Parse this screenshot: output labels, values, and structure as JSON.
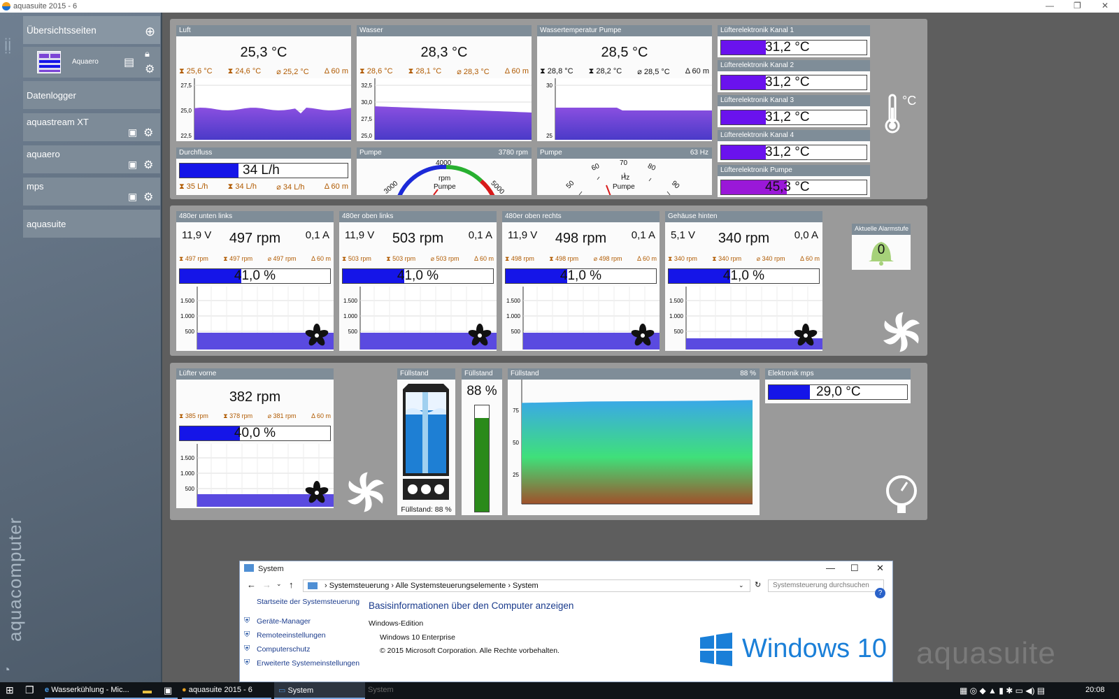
{
  "window": {
    "title": "aquasuite 2015 - 6",
    "watermark": "aquasuite"
  },
  "sidebar": {
    "overview": "Übersichtsseiten",
    "page_item": "Aquaero",
    "items": [
      {
        "label": "Datenlogger"
      },
      {
        "label": "aquastream XT"
      },
      {
        "label": "aquaero"
      },
      {
        "label": "mps"
      },
      {
        "label": "aquasuite"
      }
    ],
    "brand": "aquacomputer"
  },
  "temps": [
    {
      "title": "Luft",
      "value": "25,3 °C",
      "max": "25,6 °C",
      "min": "24,6 °C",
      "avg": "25,2 °C",
      "span": "60 m",
      "yticks": [
        "27,5",
        "25,0",
        "22,5"
      ]
    },
    {
      "title": "Wasser",
      "value": "28,3 °C",
      "max": "28,6 °C",
      "min": "28,1 °C",
      "avg": "28,3 °C",
      "span": "60 m",
      "yticks": [
        "32,5",
        "30,0",
        "27,5",
        "25,0"
      ]
    },
    {
      "title": "Wassertemperatur Pumpe",
      "value": "28,5 °C",
      "max": "28,8 °C",
      "min": "28,2 °C",
      "avg": "28,5 °C",
      "span": "60 m",
      "yticks": [
        "30",
        "25"
      ]
    }
  ],
  "flow": {
    "title": "Durchfluss",
    "value": "34 L/h",
    "max": "35 L/h",
    "min": "34 L/h",
    "avg": "34 L/h",
    "span": "60 m",
    "fill": 0.35
  },
  "pump_rpm": {
    "title": "Pumpe",
    "right": "3780 rpm",
    "ticks": [
      "3000",
      "4000",
      "5000"
    ],
    "unit": "rpm",
    "label": "Pumpe"
  },
  "pump_hz": {
    "title": "Pumpe",
    "right": "63 Hz",
    "ticks": [
      "50",
      "60",
      "70",
      "80",
      "90"
    ],
    "unit": "Hz",
    "label": "Pumpe"
  },
  "fan_channels": [
    {
      "title": "Lüfterelektronik Kanal 1",
      "value": "31,2 °C",
      "fill": 0.31
    },
    {
      "title": "Lüfterelektronik Kanal 2",
      "value": "31,2 °C",
      "fill": 0.31
    },
    {
      "title": "Lüfterelektronik Kanal 3",
      "value": "31,2 °C",
      "fill": 0.31
    },
    {
      "title": "Lüfterelektronik Kanal 4",
      "value": "31,2 °C",
      "fill": 0.31
    },
    {
      "title": "Lüfterelektronik Pumpe",
      "value": "45,3 °C",
      "fill": 0.45
    }
  ],
  "temp_unit_icon": "°C",
  "fans": [
    {
      "title": "480er unten links",
      "volt": "11,9 V",
      "rpm": "497 rpm",
      "amp": "0,1 A",
      "max": "497 rpm",
      "min": "497 rpm",
      "avg": "497 rpm",
      "span": "60 m",
      "pct": "41,0 %",
      "fill": 0.41
    },
    {
      "title": "480er oben links",
      "volt": "11,9 V",
      "rpm": "503 rpm",
      "amp": "0,1 A",
      "max": "503 rpm",
      "min": "503 rpm",
      "avg": "503 rpm",
      "span": "60 m",
      "pct": "41,0 %",
      "fill": 0.41
    },
    {
      "title": "480er oben rechts",
      "volt": "11,9 V",
      "rpm": "498 rpm",
      "amp": "0,1 A",
      "max": "498 rpm",
      "min": "498 rpm",
      "avg": "498 rpm",
      "span": "60 m",
      "pct": "41,0 %",
      "fill": 0.41
    },
    {
      "title": "Gehäuse hinten",
      "volt": "5,1 V",
      "rpm": "340 rpm",
      "amp": "0,0 A",
      "max": "340 rpm",
      "min": "340 rpm",
      "avg": "340 rpm",
      "span": "60 m",
      "pct": "41,0 %",
      "fill": 0.41
    }
  ],
  "fan_yticks": [
    "1.500",
    "1.000",
    "500"
  ],
  "alarm": {
    "title": "Aktuelle Alarmstufe",
    "value": "0"
  },
  "front_fan": {
    "title": "Lüfter vorne",
    "rpm": "382 rpm",
    "max": "385 rpm",
    "min": "378 rpm",
    "avg": "381 rpm",
    "span": "60 m",
    "pct": "40,0 %",
    "fill": 0.4
  },
  "level": {
    "title": "Füllstand",
    "caption": "Füllstand: 88 %"
  },
  "level_bar": {
    "title": "Füllstand",
    "value": "88 %",
    "fraction": 0.88
  },
  "level_chart": {
    "title": "Füllstand",
    "right": "88 %",
    "yticks": [
      "75",
      "50",
      "25"
    ]
  },
  "elektronik": {
    "title": "Elektronik mps",
    "value": "29,0 °C",
    "fill": 0.3
  },
  "system_window": {
    "title": "System",
    "breadcrumb": [
      "Systemsteuerung",
      "Alle Systemsteuerungselemente",
      "System"
    ],
    "search_placeholder": "Systemsteuerung durchsuchen",
    "home_link": "Startseite der Systemsteuerung",
    "links": [
      "Geräte-Manager",
      "Remoteeinstellungen",
      "Computerschutz",
      "Erweiterte Systemeinstellungen"
    ],
    "heading": "Basisinformationen über den Computer anzeigen",
    "edition_label": "Windows-Edition",
    "edition": "Windows 10 Enterprise",
    "copyright": "© 2015 Microsoft Corporation. Alle Rechte vorbehalten.",
    "logo_text": "Windows 10",
    "help": "?"
  },
  "taskbar": {
    "apps": [
      "Wasserkühlung - Mic...",
      "aquasuite 2015 - 6",
      "System"
    ],
    "time": "20:08",
    "ghost": "System"
  },
  "colors": {
    "fill": "#1515e8",
    "purple": "#7c45d6",
    "header": "#7f8d98"
  }
}
